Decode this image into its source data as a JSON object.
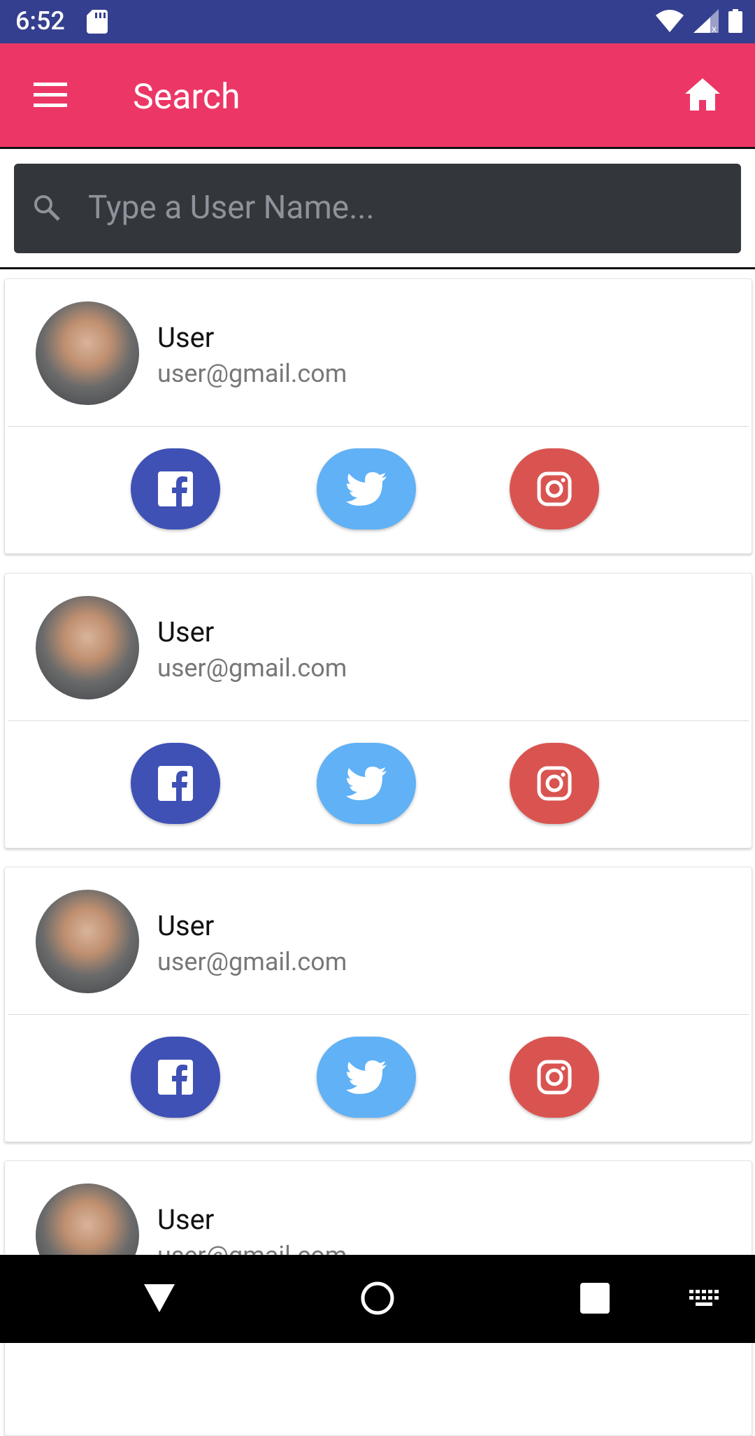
{
  "status_bar": {
    "time": "6:52"
  },
  "app_bar": {
    "title": "Search"
  },
  "search": {
    "placeholder": "Type a User Name..."
  },
  "users": [
    {
      "name": "User",
      "email": "user@gmail.com"
    },
    {
      "name": "User",
      "email": "user@gmail.com"
    },
    {
      "name": "User",
      "email": "user@gmail.com"
    },
    {
      "name": "User",
      "email": "user@gmail.com"
    }
  ],
  "colors": {
    "status_bar": "#353f8f",
    "app_bar": "#ec3766",
    "search_bg": "#33363b",
    "facebook": "#3f51b5",
    "twitter": "#60b1f5",
    "instagram": "#d95450"
  },
  "icons": [
    "menu-icon",
    "home-icon",
    "search-icon",
    "facebook-icon",
    "twitter-icon",
    "instagram-icon",
    "back-icon",
    "home-nav-icon",
    "recents-icon",
    "keyboard-icon"
  ]
}
